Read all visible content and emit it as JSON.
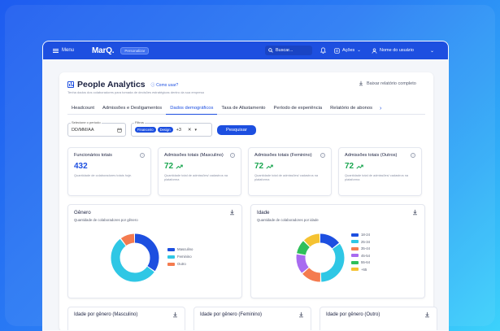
{
  "topbar": {
    "menu_label": "Menu",
    "logo": "MarQ.",
    "tag": "Personalizar",
    "search_label": "Buscar...",
    "actions_label": "Ações",
    "user_label": "Nome do usuário"
  },
  "page": {
    "title": "People Analytics",
    "how_to": "Como usar?",
    "subtitle": "Tenha dados dos colaboradores para tomada de decisões estratégicas dentro da sua empresa",
    "download_report": "Baixar relatório completo"
  },
  "tabs": [
    {
      "label": "Headcount"
    },
    {
      "label": "Admissões e Desligamentos"
    },
    {
      "label": "Dados demográficos"
    },
    {
      "label": "Taxa de Afastamento"
    },
    {
      "label": "Período de experiência"
    },
    {
      "label": "Relatório de abonos"
    }
  ],
  "filters": {
    "period_label": "Selecione o período",
    "period_placeholder": "DD/MM/AA",
    "filters_label": "Filtros",
    "chips": [
      "Financeiro",
      "Design"
    ],
    "more_count": "+3",
    "search_button": "Pesquisar"
  },
  "kpis": [
    {
      "title": "Funcionários totais",
      "value": "432",
      "desc": "Quantidade de colaboradores totais hoje.",
      "color": "#1d4fe0",
      "trend": false
    },
    {
      "title": "Admissões totais (Masculino)",
      "value": "72",
      "desc": "Quantidade total de admissões/ cadastros na plataforma",
      "color": "#1aa650",
      "trend": true
    },
    {
      "title": "Admissões totais (Feminino)",
      "value": "72",
      "desc": "Quantidade total de admissões/ cadastros na plataforma",
      "color": "#1aa650",
      "trend": true
    },
    {
      "title": "Admissões totais (Outros)",
      "value": "72",
      "desc": "Quantidade total de admissões/ cadastros na plataforma",
      "color": "#1aa650",
      "trend": true
    }
  ],
  "charts": {
    "gender": {
      "title": "Gênero",
      "subtitle": "Quantidade de colaboradores por gênero",
      "legend": [
        {
          "label": "Masculino",
          "color": "#1d4fe0",
          "value": 35
        },
        {
          "label": "Feminino",
          "color": "#2fc7e5",
          "value": 55
        },
        {
          "label": "Outro",
          "color": "#f47b4f",
          "value": 10
        }
      ]
    },
    "age": {
      "title": "Idade",
      "subtitle": "Quantidade de colaboradores por idade",
      "legend": [
        {
          "label": "18-24",
          "color": "#1d4fe0",
          "value": 15
        },
        {
          "label": "25-34",
          "color": "#2fc7e5",
          "value": 35
        },
        {
          "label": "35-44",
          "color": "#f47b4f",
          "value": 14
        },
        {
          "label": "45-54",
          "color": "#a86bf0",
          "value": 14
        },
        {
          "label": "55-64",
          "color": "#2fbf5a",
          "value": 10
        },
        {
          "label": "+65",
          "color": "#f5c231",
          "value": 12
        }
      ]
    }
  },
  "bottom_cards": [
    {
      "title": "Idade por gênero (Masculino)"
    },
    {
      "title": "Idade por gênero (Feminino)"
    },
    {
      "title": "Idade por gênero (Outro)"
    }
  ]
}
